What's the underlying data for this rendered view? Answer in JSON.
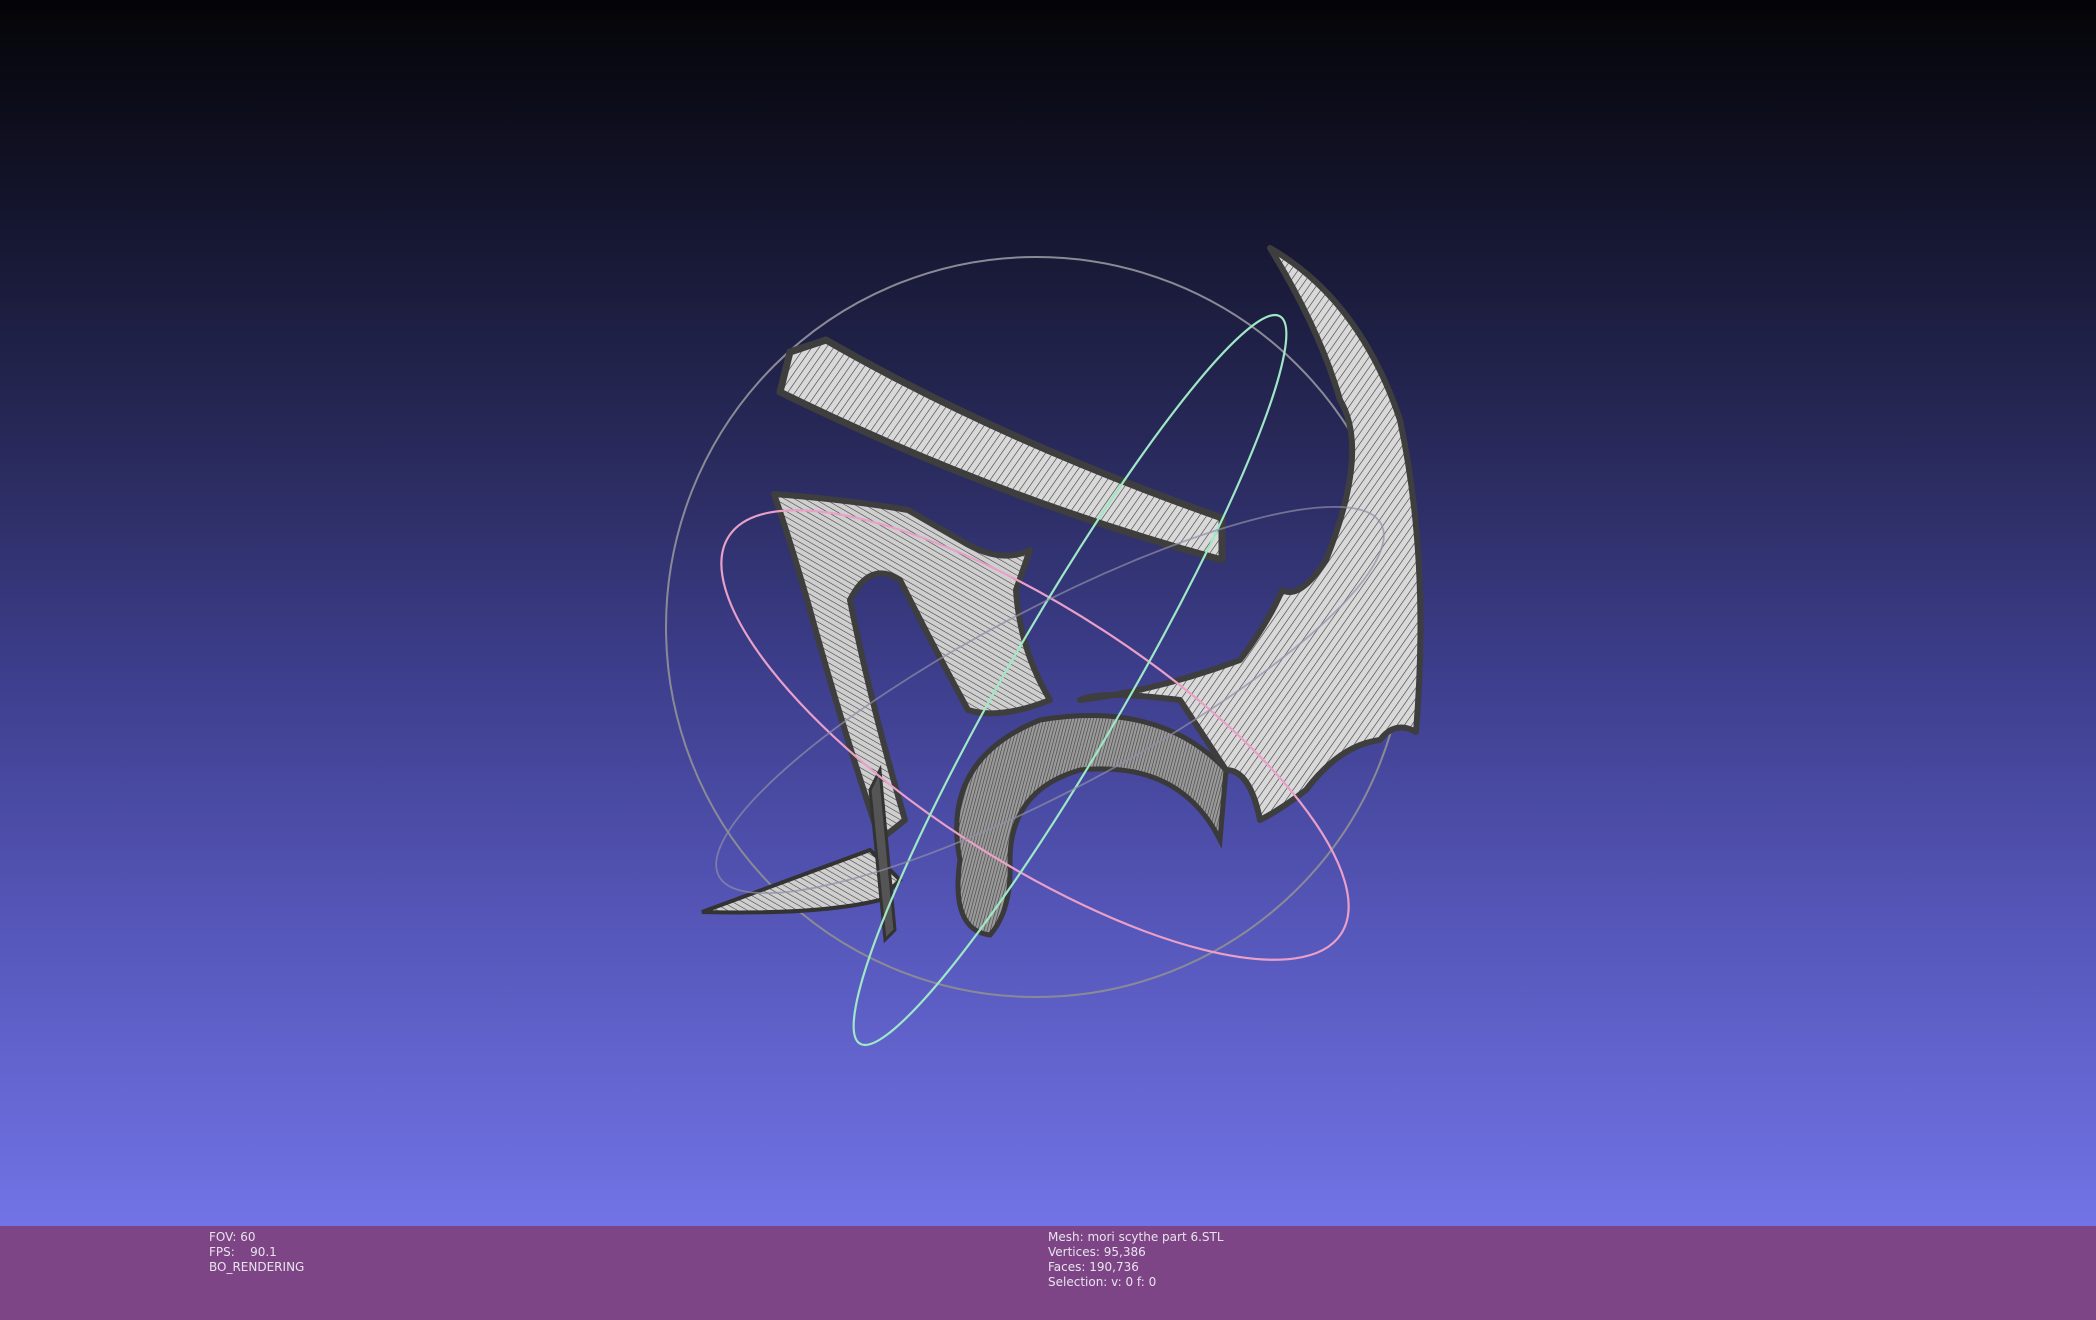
{
  "viewport": {
    "background_top": "#040407",
    "background_bottom": "#7273e6"
  },
  "scene": {
    "mesh_color": "#4a4a4a",
    "mesh_fill": "#d8d8d8",
    "trackball_colors": {
      "sphere": "#8a8a96",
      "x_ring": "#e9a0c8",
      "y_ring": "#9ee8c6",
      "z_ring": "#a0a0c0"
    }
  },
  "info_bar": {
    "background": "#7d4585",
    "left": {
      "fov_label": "FOV:",
      "fov_value": "60",
      "fps_label": "FPS:",
      "fps_value": "90.1",
      "mode": "BO_RENDERING"
    },
    "right": {
      "mesh_label": "Mesh:",
      "mesh_name": "mori scythe part 6.STL",
      "vertices_label": "Vertices:",
      "vertices_value": "95,386",
      "faces_label": "Faces:",
      "faces_value": "190,736",
      "selection_label": "Selection:",
      "selection_value": "v: 0 f: 0"
    }
  }
}
